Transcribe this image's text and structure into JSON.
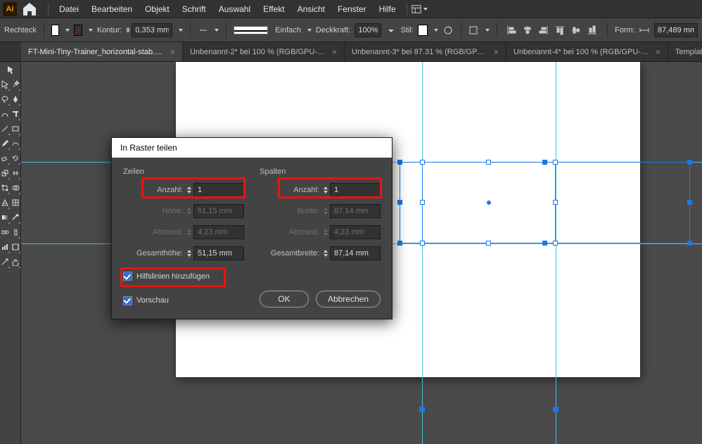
{
  "menu": {
    "items": [
      "Datei",
      "Bearbeiten",
      "Objekt",
      "Schrift",
      "Auswahl",
      "Effekt",
      "Ansicht",
      "Fenster",
      "Hilfe"
    ]
  },
  "control": {
    "shape_label": "Rechteck",
    "kontur_label": "Kontur:",
    "kontur_value": "0,353 mm",
    "stroke_kind": "Einfach",
    "opacity_label": "Deckkraft:",
    "opacity_value": "100%",
    "stil_label": "Stil:",
    "form_label": "Form:",
    "form_value": "87,489 mm"
  },
  "tabs": [
    {
      "label": "FT-Mini-Tiny-Trainer_horizontal-stab.pdf*",
      "active": true
    },
    {
      "label": "Unbenannt-2* bei 100 % (RGB/GPU-Vors…",
      "active": false
    },
    {
      "label": "Unbenannt-3* bei 87.31 % (RGB/GPU-Vo…",
      "active": false
    },
    {
      "label": "Unbenannt-4* bei 100 % (RGB/GPU-Vors…",
      "active": false
    },
    {
      "label": "Template.ai*",
      "active": false
    }
  ],
  "dialog": {
    "title": "In Raster teilen",
    "rows_label": "Zeilen",
    "cols_label": "Spalten",
    "count_label": "Anzahl:",
    "rows_count": "1",
    "cols_count": "1",
    "height_label": "Höhe:",
    "height_value": "51,15 mm",
    "width_label": "Breite:",
    "width_value": "87,14 mm",
    "gutter_label": "Abstand:",
    "gutter_value": "4,23 mm",
    "totalh_label": "Gesamthöhe:",
    "totalh_value": "51,15 mm",
    "totalw_label": "Gesamtbreite:",
    "totalw_value": "87,14 mm",
    "add_guides_label": "Hilfslinien hinzufügen",
    "preview_label": "Vorschau",
    "ok": "OK",
    "cancel": "Abbrechen"
  },
  "colors": {
    "accent": "#1878e9",
    "guide": "#3ec1ec",
    "highlight": "#e11"
  }
}
